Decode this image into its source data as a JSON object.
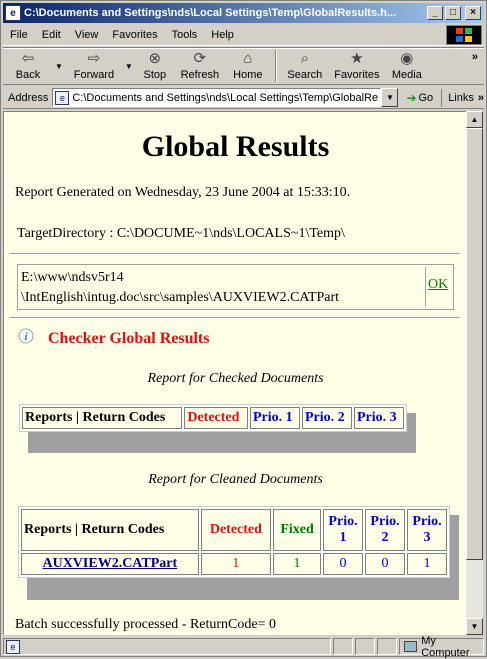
{
  "window": {
    "title": "C:\\Documents and Settings\\nds\\Local Settings\\Temp\\GlobalResults.h...",
    "buttons": {
      "minimize": "_",
      "maximize": "□",
      "close": "×"
    }
  },
  "menu": [
    "File",
    "Edit",
    "View",
    "Favorites",
    "Tools",
    "Help"
  ],
  "toolbar": {
    "back": "Back",
    "forward": "Forward",
    "stop": "Stop",
    "refresh": "Refresh",
    "home": "Home",
    "search": "Search",
    "favorites": "Favorites",
    "media": "Media",
    "overflow": "»"
  },
  "address": {
    "label": "Address",
    "value": "C:\\Documents and Settings\\nds\\Local Settings\\Temp\\GlobalRe",
    "go": "Go",
    "links": "Links",
    "links_overflow": "»"
  },
  "page": {
    "title": "Global Results",
    "generated": "Report Generated on Wednesday, 23 June 2004 at 15:33:10.",
    "target_dir": "TargetDirectory : C:\\DOCUME~1\\nds\\LOCALS~1\\Temp\\",
    "file_line1": "E:\\www\\ndsv5r14",
    "file_line2": "\\IntEnglish\\intug.doc\\src\\samples\\AUXVIEW2.CATPart",
    "file_status": "OK",
    "checker_title": "Checker Global Results",
    "checked_caption": "Report for Checked Documents",
    "checked_headers": [
      "Reports | Return Codes",
      "Detected",
      "Prio. 1",
      "Prio. 2",
      "Prio. 3"
    ],
    "cleaned_caption": "Report for Cleaned Documents",
    "cleaned_headers": [
      "Reports | Return Codes",
      "Detected",
      "Fixed",
      "Prio. 1",
      "Prio. 2",
      "Prio. 3"
    ],
    "cleaned_row": [
      "AUXVIEW2.CATPart",
      "1",
      "1",
      "0",
      "0",
      "1"
    ],
    "batch": "Batch successfully processed - ReturnCode= 0"
  },
  "status": {
    "zone": "My Computer"
  },
  "colors": {
    "page_bg": "#ffffe7",
    "red": "#dd1111",
    "blue": "#0000cc",
    "green": "#007700",
    "title_gradient_start": "#0a246a"
  }
}
